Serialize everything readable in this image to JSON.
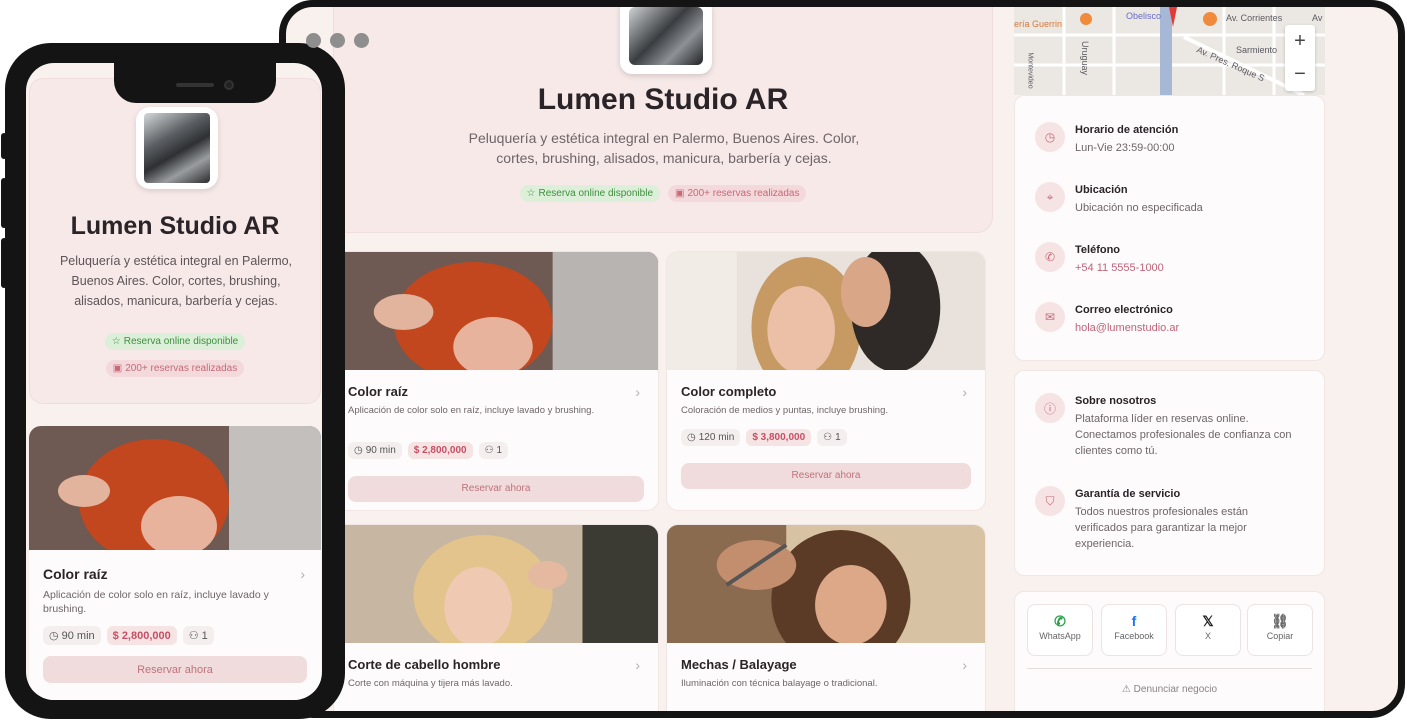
{
  "business": {
    "name": "Lumen Studio AR",
    "description": "Peluquería y estética integral en Palermo, Buenos Aires. Color, cortes, brushing, alisados, manicura, barbería y cejas.",
    "badge_online": "Reserva online disponible",
    "badge_bookings": "200+ reservas realizadas"
  },
  "services": [
    {
      "name": "Color raíz",
      "description": "Aplicación de color solo en raíz, incluye lavado y brushing.",
      "duration": "90 min",
      "price": "$ 2,800,000",
      "capacity": "1",
      "cta": "Reservar ahora"
    },
    {
      "name": "Color completo",
      "description": "Coloración de medios y puntas, incluye brushing.",
      "duration": "120 min",
      "price": "$ 3,800,000",
      "capacity": "1",
      "cta": "Reservar ahora"
    },
    {
      "name": "Corte de cabello hombre",
      "description": "Corte con máquina y tijera más lavado."
    },
    {
      "name": "Mechas / Balayage",
      "description": "Iluminación con técnica balayage o tradicional."
    }
  ],
  "map": {
    "labels": [
      "ería Guerrin",
      "Obelisco",
      "Av. Corrientes",
      "Av",
      "Sarmiento",
      "Uruguay",
      "Montevideo",
      "Av. Pres. Roque S"
    ],
    "zoom_in": "+",
    "zoom_out": "−"
  },
  "contact": [
    {
      "label": "Horario de atención",
      "value": "Lun-Vie 23:59-00:00",
      "icon": "clock-icon"
    },
    {
      "label": "Ubicación",
      "value": "Ubicación no especificada",
      "icon": "location-pin-icon"
    },
    {
      "label": "Teléfono",
      "value": "+54 11 5555-1000",
      "icon": "phone-icon"
    },
    {
      "label": "Correo electrónico",
      "value": "hola@lumenstudio.ar",
      "icon": "mail-icon"
    }
  ],
  "about": [
    {
      "label": "Sobre nosotros",
      "value": "Plataforma líder en reservas online. Conectamos profesionales de confianza con clientes como tú.",
      "icon": "info-icon"
    },
    {
      "label": "Garantía de servicio",
      "value": "Todos nuestros profesionales están verificados para garantizar la mejor experiencia.",
      "icon": "shield-icon"
    }
  ],
  "share": [
    {
      "label": "WhatsApp",
      "icon": "whatsapp-icon",
      "color": "#25a244"
    },
    {
      "label": "Facebook",
      "icon": "facebook-icon",
      "color": "#1877f2"
    },
    {
      "label": "X",
      "icon": "twitter-icon",
      "color": "#222222"
    },
    {
      "label": "Copiar",
      "icon": "link-icon",
      "color": "#666666"
    }
  ],
  "report": "Denunciar negocio",
  "colors": {
    "accent": "#c0647a",
    "background": "#f8f1ee",
    "green": "#3f8f3f"
  }
}
